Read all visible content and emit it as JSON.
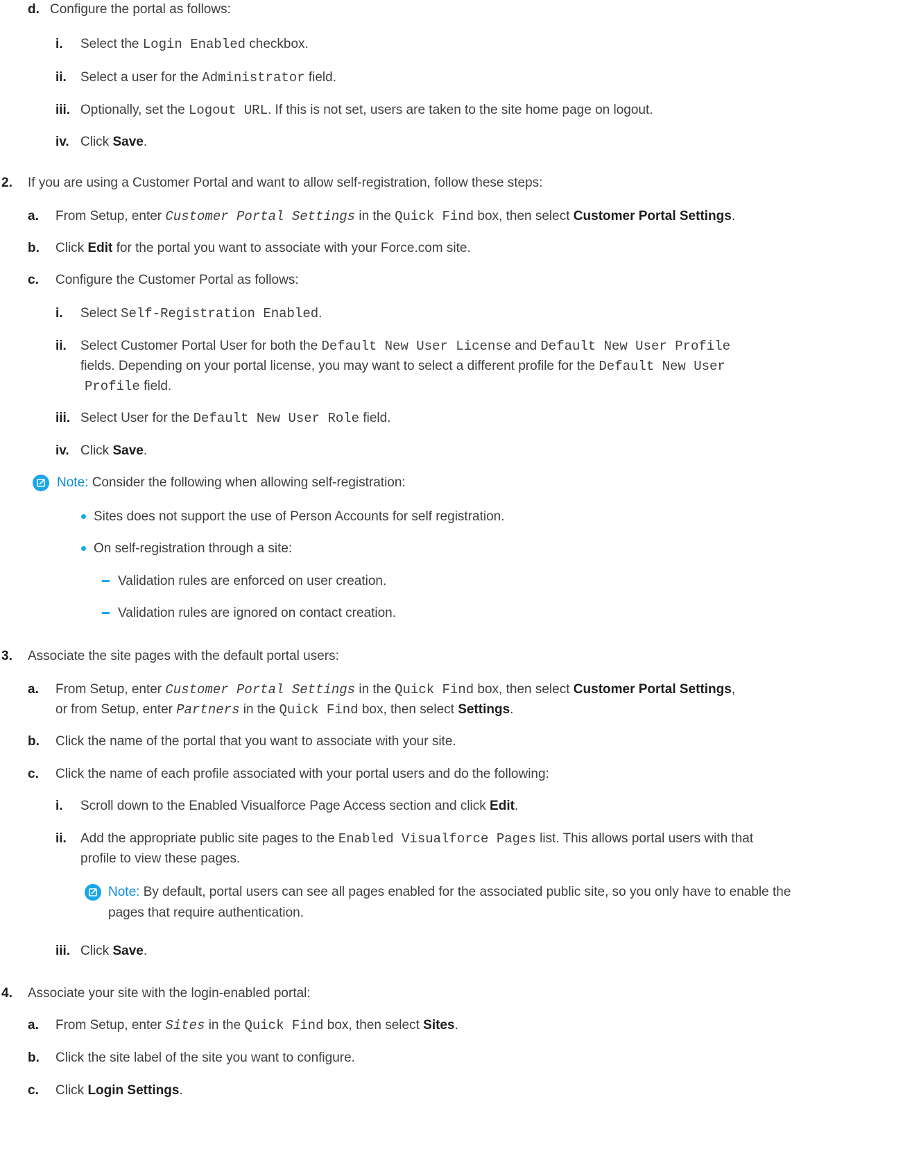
{
  "steps": {
    "d_marker": "d.",
    "d_text": "Configure the portal as follows:",
    "d_i": {
      "m": "i.",
      "t1": "Select the ",
      "code": "Login Enabled",
      "t2": " checkbox."
    },
    "d_ii": {
      "m": "ii.",
      "t1": "Select a user for the ",
      "code": "Administrator",
      "t2": " field."
    },
    "d_iii": {
      "m": "iii.",
      "t1": "Optionally, set the ",
      "code": "Logout URL",
      "t2": ". If this is not set, users are taken to the site home page on logout."
    },
    "d_iv": {
      "m": "iv.",
      "t1": "Click ",
      "b": "Save",
      "t2": "."
    },
    "s2": {
      "m": "2.",
      "t": "If you are using a Customer Portal and want to allow self-registration, follow these steps:"
    },
    "s2a": {
      "m": "a.",
      "t1": "From Setup, enter ",
      "code_i": "Customer Portal Settings",
      "t2": " in the ",
      "code": "Quick Find",
      "t3": " box, then select ",
      "b": "Customer Portal Settings",
      "t4": "."
    },
    "s2b": {
      "m": "b.",
      "t1": "Click ",
      "b": "Edit",
      "t2": " for the portal you want to associate with your Force.com site."
    },
    "s2c": {
      "m": "c.",
      "t": "Configure the Customer Portal as follows:"
    },
    "s2c_i": {
      "m": "i.",
      "t1": "Select ",
      "code": "Self-Registration Enabled",
      "t2": "."
    },
    "s2c_ii": {
      "m": "ii.",
      "t1": "Select Customer Portal User for both the ",
      "code1": "Default New User License",
      "t2": " and ",
      "code2": "Default New User Profile",
      "l2t1": "fields. Depending on your portal license, you may want to select a different profile for the ",
      "l2code": "Default New User",
      "l3code": "Profile",
      "l3t": " field."
    },
    "s2c_iii": {
      "m": "iii.",
      "t1": "Select User for the ",
      "code": "Default New User Role",
      "t2": " field."
    },
    "s2c_iv": {
      "m": "iv.",
      "t1": "Click ",
      "b": "Save",
      "t2": "."
    },
    "note1": {
      "label": "Note:",
      "t": " Consider the following when allowing self-registration:",
      "bullet1": "Sites does not support the use of Person Accounts for self registration.",
      "bullet2": "On self-registration through a site:",
      "dash1": "Validation rules are enforced on user creation.",
      "dash2": "Validation rules are ignored on contact creation."
    },
    "s3": {
      "m": "3.",
      "t": "Associate the site pages with the default portal users:"
    },
    "s3a": {
      "m": "a.",
      "t1": "From Setup, enter ",
      "code_i": "Customer Portal Settings",
      "t2": " in the ",
      "code": "Quick Find",
      "t3": " box, then select ",
      "b": "Customer Portal Settings",
      "t4": ",",
      "l2t1": "or from Setup, enter ",
      "l2code_i": "Partners",
      "l2t2": " in the ",
      "l2code": "Quick Find",
      "l2t3": " box, then select ",
      "l2b": "Settings",
      "l2t4": "."
    },
    "s3b": {
      "m": "b.",
      "t": "Click the name of the portal that you want to associate with your site."
    },
    "s3c": {
      "m": "c.",
      "t": "Click the name of each profile associated with your portal users and do the following:"
    },
    "s3c_i": {
      "m": "i.",
      "t1": "Scroll down to the Enabled Visualforce Page Access section and click ",
      "b": "Edit",
      "t2": "."
    },
    "s3c_ii": {
      "m": "ii.",
      "t1": "Add the appropriate public site pages to the ",
      "code": "Enabled Visualforce Pages",
      "t2": " list. This allows portal users with that",
      "l2": "profile to view these pages."
    },
    "note2": {
      "label": "Note:",
      "t": " By default, portal users can see all pages enabled for the associated public site, so you only have to enable the",
      "l2": "pages that require authentication."
    },
    "s3c_iii": {
      "m": "iii.",
      "t1": "Click ",
      "b": "Save",
      "t2": "."
    },
    "s4": {
      "m": "4.",
      "t": "Associate your site with the login-enabled portal:"
    },
    "s4a": {
      "m": "a.",
      "t1": "From Setup, enter ",
      "code_i": "Sites",
      "t2": " in the ",
      "code": "Quick Find",
      "t3": " box, then select ",
      "b": "Sites",
      "t4": "."
    },
    "s4b": {
      "m": "b.",
      "t": "Click the site label of the site you want to configure."
    },
    "s4c": {
      "m": "c.",
      "t1": "Click ",
      "b": "Login Settings",
      "t2": "."
    }
  },
  "icons": {
    "note": "edit-note-icon",
    "bullet": "bullet-dot",
    "dash": "dash-bullet"
  },
  "colors": {
    "accent": "#1ba6e9",
    "note_label": "#0b8cd6",
    "text": "#3e3e3c"
  }
}
